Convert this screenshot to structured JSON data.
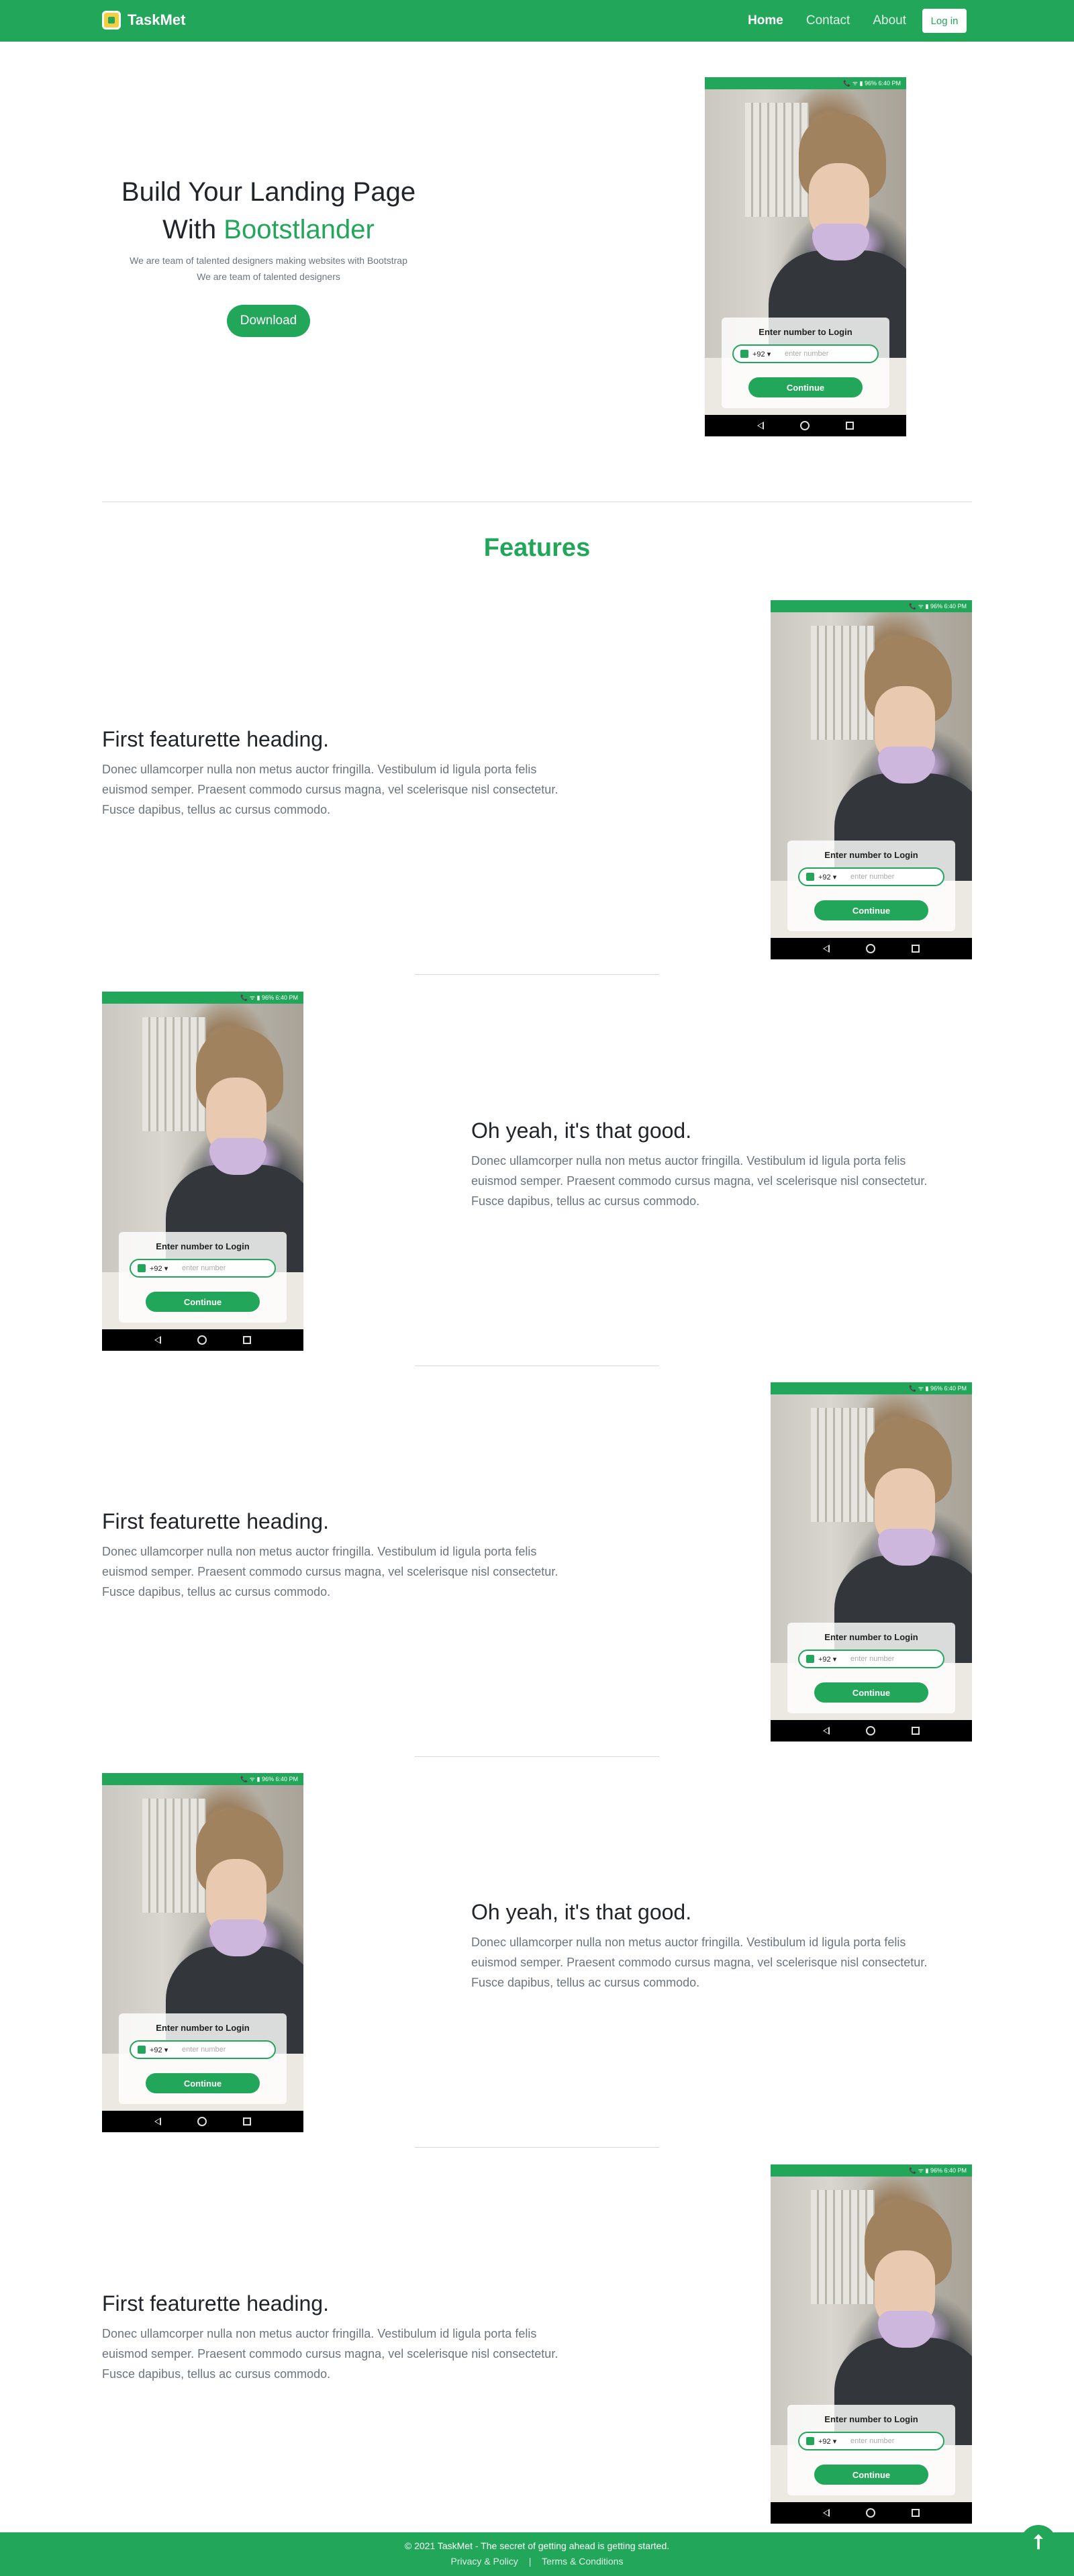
{
  "nav": {
    "brand": "TaskMet",
    "links": [
      "Home",
      "Contact",
      "About"
    ],
    "login": "Log in"
  },
  "hero": {
    "title_line1": "Build Your Landing Page",
    "title_with": "With",
    "title_accent": "Bootstlander",
    "subtitle_line1": "We are team of talented designers making websites with Bootstrap",
    "subtitle_line2": "We are team of talented designers",
    "download": "Download"
  },
  "phone": {
    "status_left": "",
    "status_right": "📞 ᯤ ▮ 96% 6:40 PM",
    "card_title": "Enter number to Login",
    "country_code": "+92 ▾",
    "placeholder": "enter number",
    "continue": "Continue"
  },
  "features": {
    "title": "Features",
    "items": [
      {
        "heading": "First featurette heading.",
        "text": "Donec ullamcorper nulla non metus auctor fringilla. Vestibulum id ligula porta felis euismod semper. Praesent commodo cursus magna, vel scelerisque nisl consectetur. Fusce dapibus, tellus ac cursus commodo."
      },
      {
        "heading": "Oh yeah, it's that good.",
        "text": "Donec ullamcorper nulla non metus auctor fringilla. Vestibulum id ligula porta felis euismod semper. Praesent commodo cursus magna, vel scelerisque nisl consectetur. Fusce dapibus, tellus ac cursus commodo."
      },
      {
        "heading": "First featurette heading.",
        "text": "Donec ullamcorper nulla non metus auctor fringilla. Vestibulum id ligula porta felis euismod semper. Praesent commodo cursus magna, vel scelerisque nisl consectetur. Fusce dapibus, tellus ac cursus commodo."
      },
      {
        "heading": "Oh yeah, it's that good.",
        "text": "Donec ullamcorper nulla non metus auctor fringilla. Vestibulum id ligula porta felis euismod semper. Praesent commodo cursus magna, vel scelerisque nisl consectetur. Fusce dapibus, tellus ac cursus commodo."
      },
      {
        "heading": "First featurette heading.",
        "text": "Donec ullamcorper nulla non metus auctor fringilla. Vestibulum id ligula porta felis euismod semper. Praesent commodo cursus magna, vel scelerisque nisl consectetur. Fusce dapibus, tellus ac cursus commodo."
      }
    ]
  },
  "footer": {
    "copyright": "© 2021 TaskMet - The secret of getting ahead is getting started.",
    "privacy": "Privacy & Policy",
    "separator": "|",
    "terms": "Terms & Conditions"
  },
  "icons": {
    "to_top": "arrow-up-icon",
    "brand_logo": "taskmet-logo-icon"
  },
  "colors": {
    "brand": "#22a65a",
    "text": "#212529",
    "muted": "#6c757d"
  }
}
